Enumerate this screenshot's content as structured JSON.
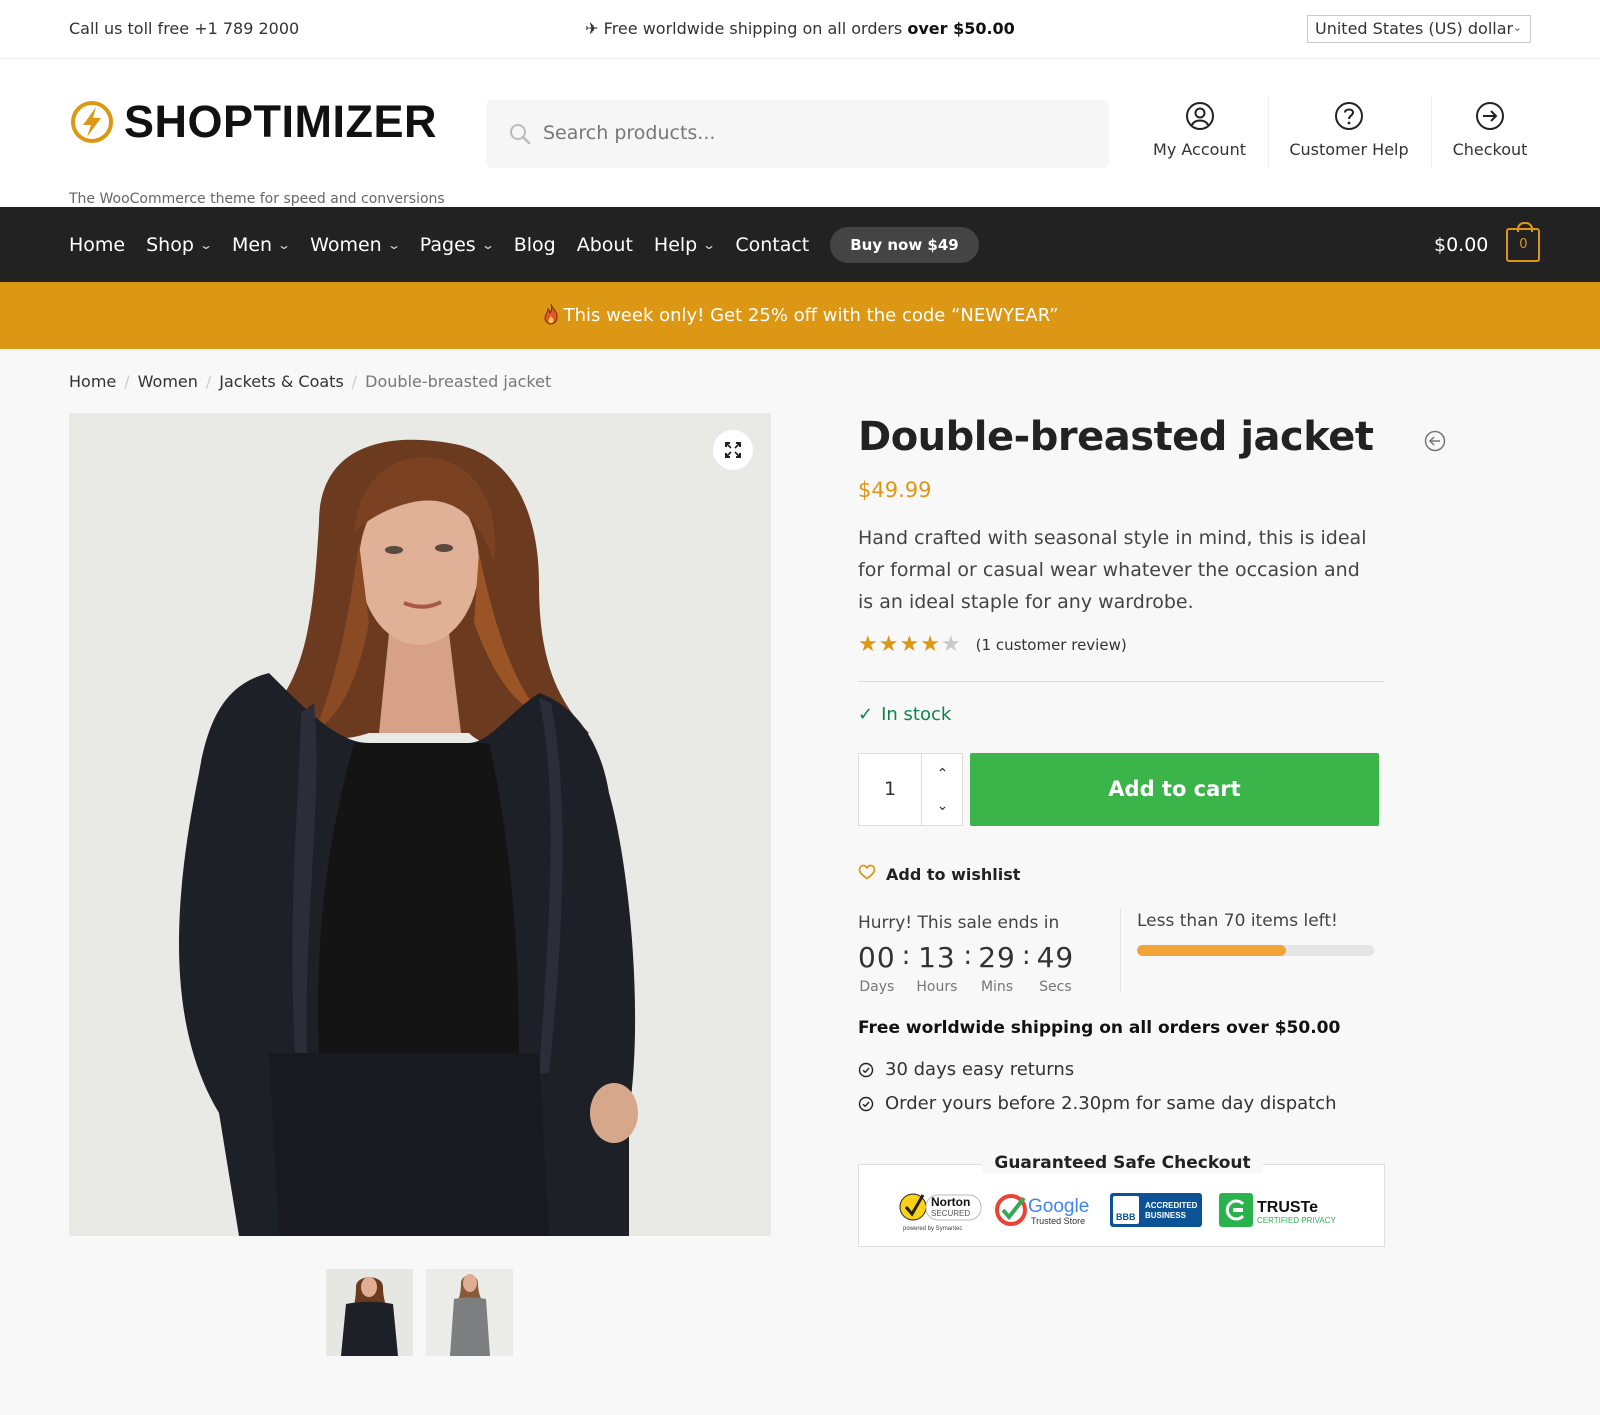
{
  "topbar": {
    "call": "Call us toll free +1 789 2000",
    "shipping_prefix": "✈ Free worldwide shipping on all orders ",
    "shipping_bold": "over $50.00",
    "currency": "United States (US) dollar"
  },
  "header": {
    "logo_text": "SHOPTIMIZER",
    "tagline": "The WooCommerce theme for speed and conversions",
    "search_placeholder": "Search products...",
    "account": "My Account",
    "help": "Customer Help",
    "checkout": "Checkout"
  },
  "nav": {
    "items": [
      "Home",
      "Shop",
      "Men",
      "Women",
      "Pages",
      "Blog",
      "About",
      "Help",
      "Contact"
    ],
    "buy_now": "Buy now $49",
    "cart_total": "$0.00",
    "cart_count": "0"
  },
  "promo": {
    "text": "This week only! Get 25% off with the code “NEWYEAR”"
  },
  "breadcrumb": [
    "Home",
    "Women",
    "Jackets & Coats",
    "Double-breasted jacket"
  ],
  "product": {
    "title": "Double-breasted jacket",
    "price": "$49.99",
    "description": "Hand crafted with seasonal style in mind, this is ideal for formal or casual wear whatever the occasion and is an ideal staple for any wardrobe.",
    "rating": 4,
    "rating_max": 5,
    "reviews": "(1 customer review)",
    "stock": "In stock",
    "quantity": "1",
    "add_to_cart": "Add to cart",
    "wishlist": "Add to wishlist"
  },
  "sale": {
    "label": "Hurry! This sale ends in",
    "days": "00",
    "hours": "13",
    "mins": "29",
    "secs": "49",
    "days_label": "Days",
    "hours_label": "Hours",
    "mins_label": "Mins",
    "secs_label": "Secs",
    "items_left": "Less than 70 items left!",
    "items_fraction": 0.63
  },
  "shipping": {
    "free": "Free worldwide shipping on all orders over $50.00",
    "benefits": [
      "30 days easy returns",
      "Order yours before 2.30pm for same day dispatch"
    ]
  },
  "checkout_box": {
    "title": "Guaranteed Safe Checkout",
    "norton": "Norton",
    "norton_sub": "SECURED",
    "norton_by": "powered by Symantec",
    "google": "Google",
    "google_sub": "Trusted Store",
    "bbb": "BBB",
    "bbb_line1": "ACCREDITED",
    "bbb_line2": "BUSINESS",
    "truste": "TRUSTe",
    "truste_sub": "CERTIFIED PRIVACY"
  },
  "colors": {
    "accent": "#dc9814",
    "nav_bg": "#222222",
    "cart_button": "#3bb54a",
    "stock_green": "#0f834d",
    "progress": "#f2a33a"
  },
  "icons": [
    "lightning-logo-icon",
    "search-icon",
    "account-icon",
    "help-icon",
    "checkout-icon",
    "chevron-down-icon",
    "cart-bag-icon",
    "fire-icon",
    "expand-icon",
    "back-icon",
    "star-icon",
    "check-icon",
    "chevron-up-icon",
    "heart-icon",
    "circle-check-icon"
  ]
}
